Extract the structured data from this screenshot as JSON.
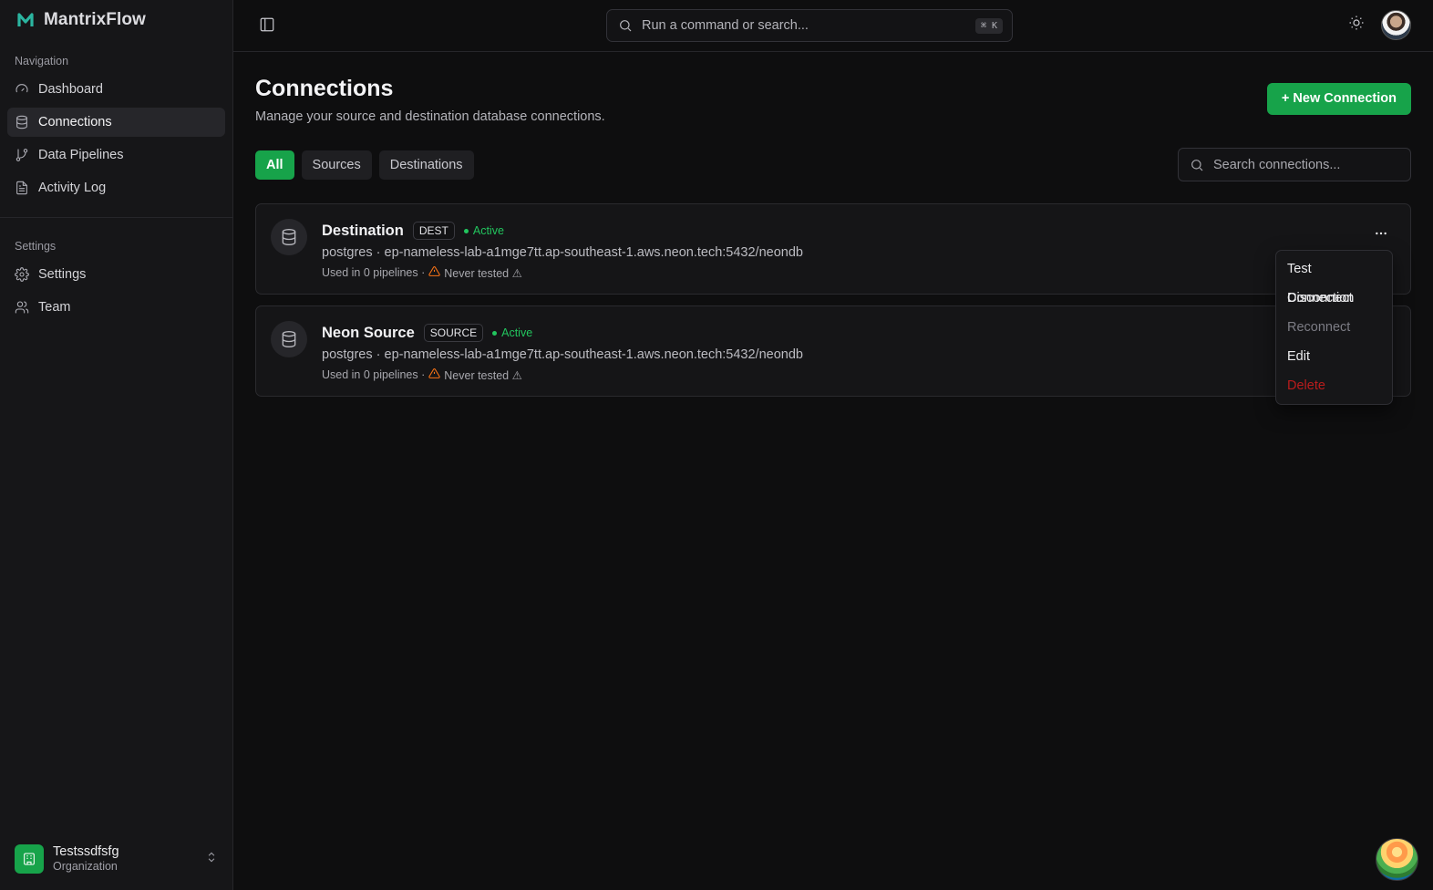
{
  "brand": {
    "name": "MantrixFlow"
  },
  "sidebar": {
    "nav_label": "Navigation",
    "nav_items": [
      {
        "label": "Dashboard",
        "icon": "gauge-icon"
      },
      {
        "label": "Connections",
        "icon": "database-icon"
      },
      {
        "label": "Data Pipelines",
        "icon": "git-branch-icon"
      },
      {
        "label": "Activity Log",
        "icon": "file-text-icon"
      }
    ],
    "settings_label": "Settings",
    "settings_items": [
      {
        "label": "Settings",
        "icon": "gear-icon"
      },
      {
        "label": "Team",
        "icon": "users-icon"
      }
    ],
    "org": {
      "name": "Testssdfsfg",
      "type": "Organization"
    }
  },
  "topbar": {
    "search_placeholder": "Run a command or search...",
    "shortcut": "⌘ K"
  },
  "page": {
    "title": "Connections",
    "subtitle": "Manage your source and destination database connections.",
    "new_button": "+ New Connection"
  },
  "filters": {
    "tabs": [
      "All",
      "Sources",
      "Destinations"
    ],
    "active_tab": "All",
    "search_placeholder": "Search connections..."
  },
  "connections": [
    {
      "name": "Destination",
      "badge": "DEST",
      "status": "Active",
      "url": "postgres · ep-nameless-lab-a1mge7tt.ap-southeast-1.aws.neon.tech:5432/neondb",
      "pipelines": "Used in 0 pipelines ·",
      "tested": "Never tested ⚠"
    },
    {
      "name": "Neon Source",
      "badge": "SOURCE",
      "status": "Active",
      "url": "postgres · ep-nameless-lab-a1mge7tt.ap-southeast-1.aws.neon.tech:5432/neondb",
      "pipelines": "Used in 0 pipelines ·",
      "tested": "Never tested ⚠"
    }
  ],
  "menu": {
    "items": [
      "Test Connection",
      "Disconnect",
      "Reconnect",
      "Edit",
      "Delete"
    ]
  },
  "colors": {
    "accent": "#17a34a",
    "status_active": "#22c55e",
    "warning": "#f97316",
    "danger": "#b91c1c"
  }
}
